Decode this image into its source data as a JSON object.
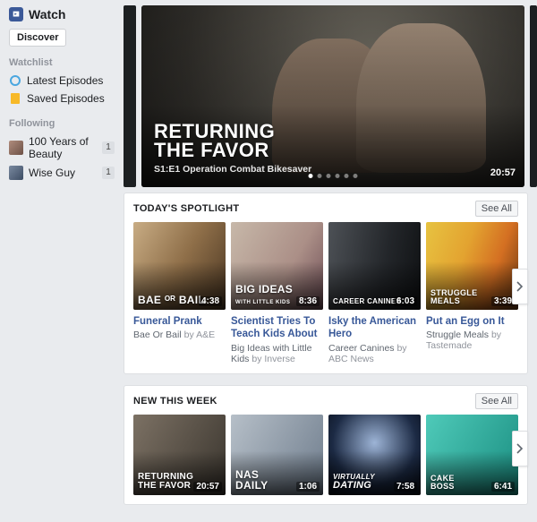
{
  "brand": {
    "label": "Watch"
  },
  "discover": {
    "label": "Discover"
  },
  "watchlist": {
    "title": "Watchlist",
    "latest": "Latest Episodes",
    "saved": "Saved Episodes"
  },
  "following": {
    "title": "Following",
    "items": [
      {
        "label": "100 Years of Beauty",
        "badge": "1"
      },
      {
        "label": "Wise Guy",
        "badge": "1"
      }
    ]
  },
  "hero": {
    "title_line1": "RETURNING",
    "title_line2": "THE FAVOR",
    "subtitle": "S1:E1 Operation Combat Bikesaver",
    "duration": "20:57",
    "active_dot": 0,
    "dot_count": 6
  },
  "spotlight": {
    "title": "TODAY'S SPOTLIGHT",
    "see_all": "See All",
    "cards": [
      {
        "logo": "BAE ᴼᴿ BAIL",
        "duration": "4:38",
        "title": "Funeral Prank",
        "source": "Bae Or Bail",
        "publisher": "A&E"
      },
      {
        "logo": "BIG IDEAS",
        "logo2": "WITH LITTLE KIDS",
        "duration": "8:36",
        "title": "Scientist Tries To Teach Kids About DNA Using…",
        "source": "Big Ideas with Little Kids",
        "publisher": "Inverse"
      },
      {
        "logo": "CAREER CANINES",
        "duration": "6:03",
        "title": "Isky the American Hero",
        "source": "Career Canines",
        "publisher": "ABC News"
      },
      {
        "logo": "STRUGGLE",
        "logo2": "MEALS",
        "duration": "3:39",
        "title": "Put an Egg on It",
        "source": "Struggle Meals",
        "publisher": "Tastemade"
      }
    ]
  },
  "newthisweek": {
    "title": "NEW THIS WEEK",
    "see_all": "See All",
    "cards": [
      {
        "logo": "RETURNING",
        "logo2": "THE FAVOR",
        "duration": "20:57"
      },
      {
        "logo": "NAS",
        "logo2": "DAILY",
        "duration": "1:06"
      },
      {
        "logo": "VIRTUALLY",
        "logo2": "DATING",
        "duration": "7:58"
      },
      {
        "logo": "CAKE",
        "logo2": "BOSS",
        "duration": "6:41"
      }
    ]
  },
  "ui": {
    "by": " by "
  }
}
